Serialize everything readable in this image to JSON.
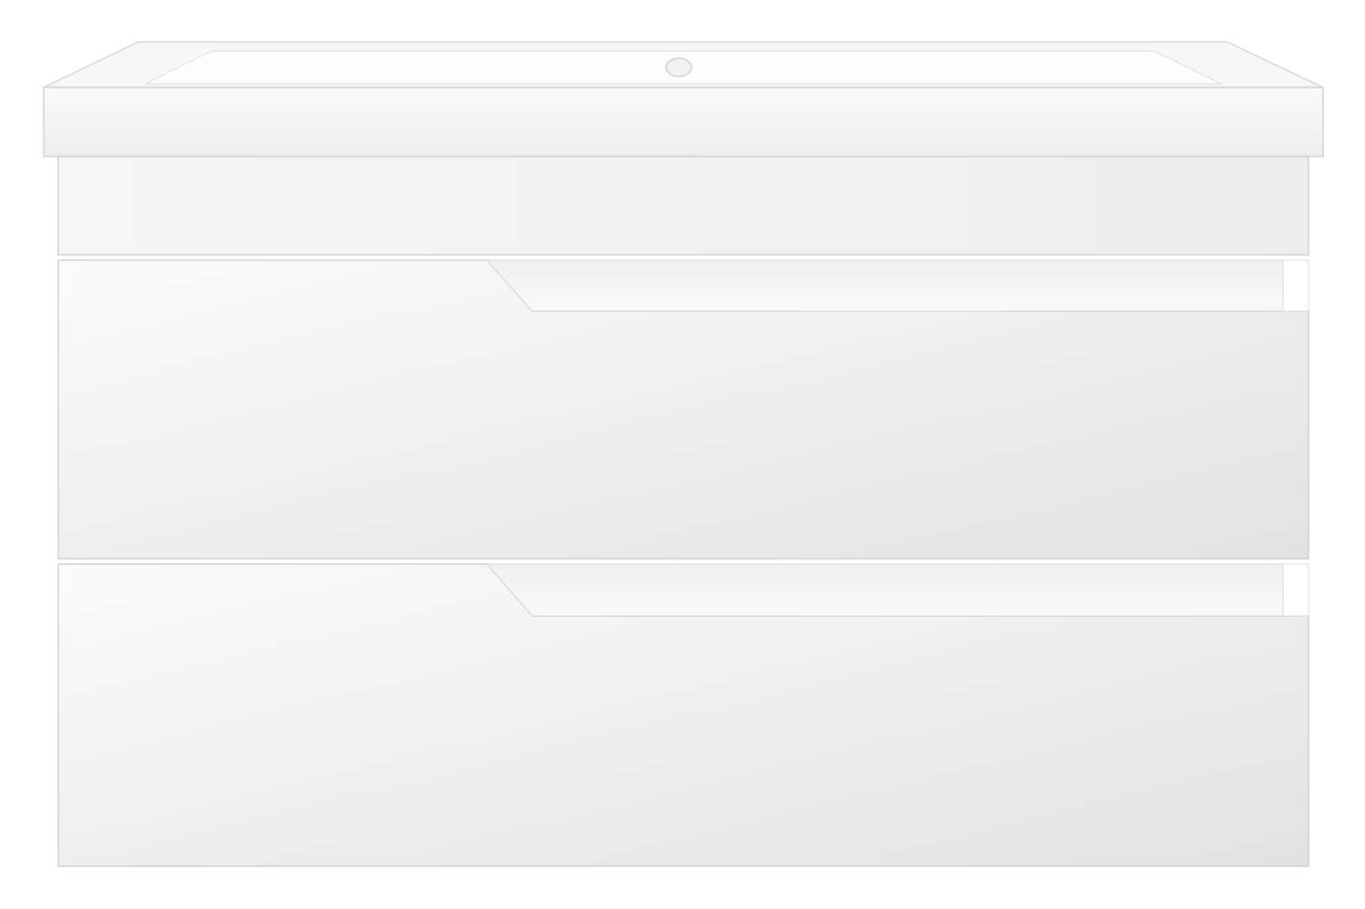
{
  "product": {
    "icon": "vanity-unit-with-sink",
    "drawer_count": 2,
    "colors": {
      "background": "#ffffff",
      "basin_top": "#f7f7f7",
      "basin_inner": "#fdfdfd",
      "cabinet_body": "#f3f3f3",
      "drawer_front_light": "#f8f8f8",
      "drawer_front_dark": "#e3e3e3",
      "edge_line": "#d0d0d0",
      "handle_groove": "#ececec"
    }
  }
}
